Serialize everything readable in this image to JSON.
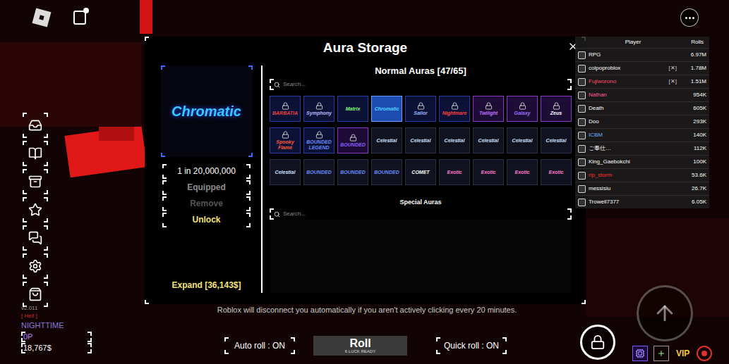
{
  "hud": {
    "version": "v2.011",
    "mode": "[ Hell ]",
    "time": "NIGHTTIME",
    "points": "0P",
    "money": "18,767$",
    "notice": "Roblox will disconnect you automatically if you aren't actively clicking every 20 minutes.",
    "vip": "VIP"
  },
  "panel": {
    "title": "Aura Storage",
    "preview": {
      "name": "Chromatic",
      "chance": "1 in 20,000,000",
      "actions": [
        {
          "label": "Equipped",
          "color": "#8c8c8c"
        },
        {
          "label": "Remove",
          "color": "#555555"
        },
        {
          "label": "Unlock",
          "color": "#f3e27a"
        }
      ]
    },
    "expand": "Expand [36,143$]",
    "normal_auras": {
      "title": "Normal Auras [47/65]",
      "search_placeholder": "Search...",
      "items": [
        {
          "name": "BARBATIA",
          "locked": true,
          "selected": false,
          "color": "#e84040",
          "kind": "blue"
        },
        {
          "name": "Symphony",
          "locked": true,
          "selected": false,
          "color": "#b8b8ff",
          "kind": "blue"
        },
        {
          "name": "Matrix",
          "locked": false,
          "selected": false,
          "color": "#7dff7d",
          "kind": "blue"
        },
        {
          "name": "Chromatic",
          "locked": false,
          "selected": true,
          "color": "#4fd4ff",
          "kind": "blue"
        },
        {
          "name": "Sailor",
          "locked": true,
          "selected": false,
          "color": "#9ab8ff",
          "kind": "blue"
        },
        {
          "name": "Nightmare",
          "locked": true,
          "selected": false,
          "color": "#ff4040",
          "kind": "blue"
        },
        {
          "name": "Twilight",
          "locked": true,
          "selected": false,
          "color": "#c070ff",
          "kind": "purple"
        },
        {
          "name": "Galaxy",
          "locked": true,
          "selected": false,
          "color": "#9a70ff",
          "kind": "purple"
        },
        {
          "name": "Zeus",
          "locked": true,
          "selected": false,
          "color": "#ffffff",
          "kind": "purple"
        },
        {
          "name": "Spooky Flame",
          "locked": true,
          "selected": false,
          "color": "#ff5a3a",
          "kind": "blue"
        },
        {
          "name": "BOUNDED LEGEND",
          "locked": true,
          "selected": false,
          "color": "#6a8aff",
          "kind": "blue"
        },
        {
          "name": "BOUNDED",
          "locked": true,
          "selected": false,
          "color": "#8a5cff",
          "kind": "purple"
        },
        {
          "name": "Celestial",
          "locked": false,
          "selected": false,
          "color": "#cfe0ff",
          "kind": "dark"
        },
        {
          "name": "Celestial",
          "locked": false,
          "selected": false,
          "color": "#cfe0ff",
          "kind": "dark"
        },
        {
          "name": "Celestial",
          "locked": false,
          "selected": false,
          "color": "#cfe0ff",
          "kind": "dark"
        },
        {
          "name": "Celestial",
          "locked": false,
          "selected": false,
          "color": "#cfe0ff",
          "kind": "dark"
        },
        {
          "name": "Celestial",
          "locked": false,
          "selected": false,
          "color": "#cfe0ff",
          "kind": "dark"
        },
        {
          "name": "Celestial",
          "locked": false,
          "selected": false,
          "color": "#cfe0ff",
          "kind": "dark"
        },
        {
          "name": "Celestial",
          "locked": false,
          "selected": false,
          "color": "#cfe0ff",
          "kind": "dark"
        },
        {
          "name": "BOUNDED",
          "locked": false,
          "selected": false,
          "color": "#6a8aff",
          "kind": "dark"
        },
        {
          "name": "BOUNDED",
          "locked": false,
          "selected": false,
          "color": "#6a8aff",
          "kind": "dark"
        },
        {
          "name": "BOUNDED",
          "locked": false,
          "selected": false,
          "color": "#6a8aff",
          "kind": "dark"
        },
        {
          "name": "COMET",
          "locked": false,
          "selected": false,
          "color": "#ffffff",
          "kind": "dark"
        },
        {
          "name": "Exotic",
          "locked": false,
          "selected": false,
          "color": "#ff7ad0",
          "kind": "dark"
        },
        {
          "name": "Exotic",
          "locked": false,
          "selected": false,
          "color": "#ff7ad0",
          "kind": "dark"
        },
        {
          "name": "Exotic",
          "locked": false,
          "selected": false,
          "color": "#ff7ad0",
          "kind": "dark"
        },
        {
          "name": "Exotic",
          "locked": false,
          "selected": false,
          "color": "#ff7ad0",
          "kind": "dark"
        }
      ]
    },
    "special_auras": {
      "title": "Special Auras",
      "search_placeholder": "Search..."
    }
  },
  "leaderboard": {
    "columns": [
      "Player",
      "Rolls"
    ],
    "rows": [
      {
        "name": "RPG",
        "rolls": "6.97M",
        "color": "#ffffff"
      },
      {
        "name": "colpoproblox",
        "rolls": "1.78M",
        "color": "#ffffff",
        "badge": "[✕]"
      },
      {
        "name": "Fujiworono",
        "rolls": "1.51M",
        "color": "#ff4d6d",
        "badge": "[✕]"
      },
      {
        "name": "Nathan",
        "rolls": "954K",
        "color": "#ff5fa0"
      },
      {
        "name": "Death",
        "rolls": "605K",
        "color": "#ffffff"
      },
      {
        "name": "Doo",
        "rolls": "293K",
        "color": "#ffffff"
      },
      {
        "name": "ICBM",
        "rolls": "140K",
        "color": "#6ab0ff"
      },
      {
        "name": "ご奉仕…",
        "rolls": "112K",
        "color": "#ffffff"
      },
      {
        "name": "King_Gaebokchi",
        "rolls": "100K",
        "color": "#ffffff"
      },
      {
        "name": "rip_storm",
        "rolls": "53.6K",
        "color": "#ff3030"
      },
      {
        "name": "messisiu",
        "rolls": "26.7K",
        "color": "#ffffff"
      },
      {
        "name": "Trowell7377",
        "rolls": "6.05K",
        "color": "#ffffff"
      }
    ]
  },
  "controls": {
    "auto_roll": "Auto roll : ON",
    "roll": "Roll",
    "roll_status": "6 LUCK READY",
    "quick_roll": "Quick roll : ON"
  }
}
